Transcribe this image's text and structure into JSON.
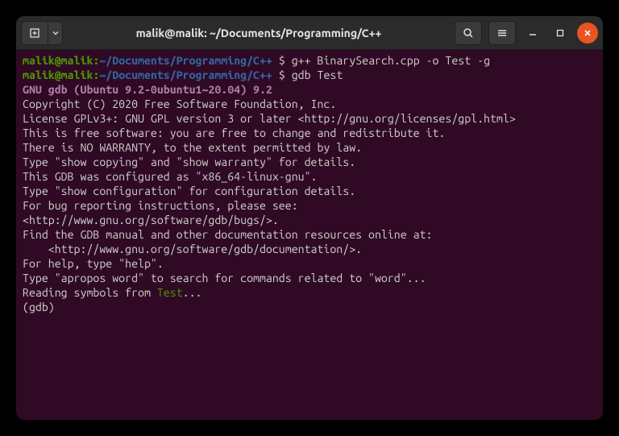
{
  "titlebar": {
    "title": "malik@malik: ~/Documents/Programming/C++"
  },
  "prompt": {
    "user_host": "malik@malik",
    "sep": ":",
    "path": "~/Documents/Programming/C++",
    "dollar": " $ "
  },
  "commands": {
    "cmd1": "g++ BinarySearch.cpp -o Test -g",
    "cmd2": "gdb Test"
  },
  "output": {
    "version": "GNU gdb (Ubuntu 9.2-0ubuntu1~20.04) 9.2",
    "l1": "Copyright (C) 2020 Free Software Foundation, Inc.",
    "l2": "License GPLv3+: GNU GPL version 3 or later <http://gnu.org/licenses/gpl.html>",
    "l3": "This is free software: you are free to change and redistribute it.",
    "l4": "There is NO WARRANTY, to the extent permitted by law.",
    "l5": "Type \"show copying\" and \"show warranty\" for details.",
    "l6": "This GDB was configured as \"x86_64-linux-gnu\".",
    "l7": "Type \"show configuration\" for configuration details.",
    "l8": "For bug reporting instructions, please see:",
    "l9": "<http://www.gnu.org/software/gdb/bugs/>.",
    "l10": "Find the GDB manual and other documentation resources online at:",
    "l11": "    <http://www.gnu.org/software/gdb/documentation/>.",
    "l12": "",
    "l13": "For help, type \"help\".",
    "l14": "Type \"apropos word\" to search for commands related to \"word\"...",
    "reading_prefix": "Reading symbols from ",
    "reading_test": "Test",
    "reading_suffix": "...",
    "gdb_prompt": "(gdb) "
  }
}
